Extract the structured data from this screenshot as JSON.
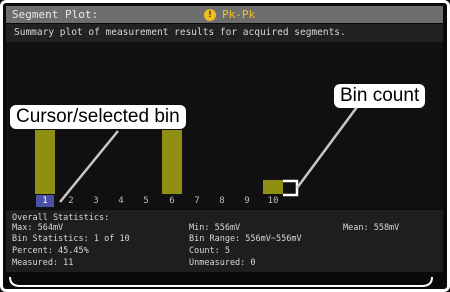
{
  "header": {
    "title": "Segment Plot:",
    "mode_icon": "!",
    "mode": "Pk-Pk"
  },
  "description": "Summary plot of measurement results for acquired segments.",
  "chart_data": {
    "type": "bar",
    "categories": [
      "1",
      "2",
      "3",
      "4",
      "5",
      "6",
      "7",
      "8",
      "9",
      "10"
    ],
    "values": [
      1.0,
      0,
      0,
      0,
      0,
      1.0,
      0,
      0,
      0,
      0.22
    ],
    "selected_bin": "1",
    "bar_color": "#8f8f14",
    "selected_color": "#4a4fa8"
  },
  "stats": {
    "heading": "Overall Statistics:",
    "max": "Max: 564mV",
    "min": "Min: 556mV",
    "mean": "Mean: 558mV",
    "bin_statistics": "Bin Statistics: 1 of 10",
    "bin_range": "Bin Range: 556mV~556mV",
    "percent": "Percent: 45.45%",
    "count": "Count: 5",
    "measured": "Measured: 11",
    "unmeasured": "Unmeasured: 0"
  },
  "annotations": {
    "cursor": "Cursor/selected bin",
    "bin_count": "Bin count"
  }
}
